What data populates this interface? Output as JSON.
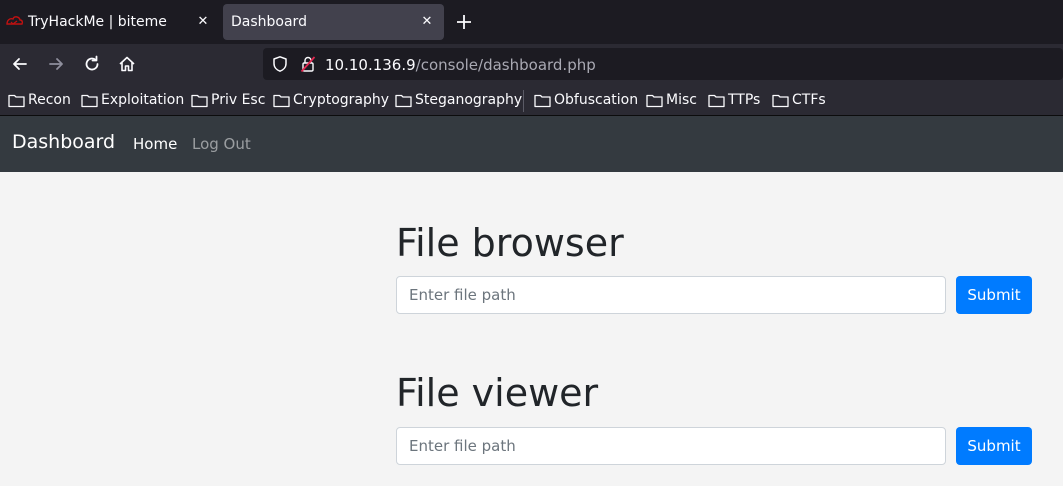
{
  "browser": {
    "tabs": [
      {
        "title": "TryHackMe | biteme",
        "active": false,
        "favicon": "tryhackme-logo-icon"
      },
      {
        "title": "Dashboard",
        "active": true
      }
    ],
    "url": {
      "host": "10.10.136.9",
      "path": "/console/dashboard.php"
    },
    "bookmarks": [
      {
        "label": "Recon",
        "icon": "folder-icon"
      },
      {
        "label": "Exploitation",
        "icon": "folder-icon"
      },
      {
        "label": "Priv Esc",
        "icon": "folder-icon"
      },
      {
        "label": "Cryptography",
        "icon": "folder-icon"
      },
      {
        "label": "Steganography",
        "icon": "folder-icon"
      },
      {
        "label": "Obfuscation",
        "icon": "folder-icon"
      },
      {
        "label": "Misc",
        "icon": "folder-icon"
      },
      {
        "label": "TTPs",
        "icon": "folder-icon"
      },
      {
        "label": "CTFs",
        "icon": "folder-icon"
      }
    ]
  },
  "app": {
    "brand": "Dashboard",
    "nav": {
      "home": "Home",
      "logout": "Log Out"
    },
    "browser_section": {
      "title": "File browser",
      "placeholder": "Enter file path",
      "button": "Submit"
    },
    "viewer_section": {
      "title": "File viewer",
      "placeholder": "Enter file path",
      "button": "Submit"
    }
  },
  "colors": {
    "navbar": "#343a40",
    "primary": "#007bff",
    "page_bg": "#f4f4f4",
    "chrome_dark": "#1c1b22",
    "chrome_toolbar": "#2b2a33"
  }
}
